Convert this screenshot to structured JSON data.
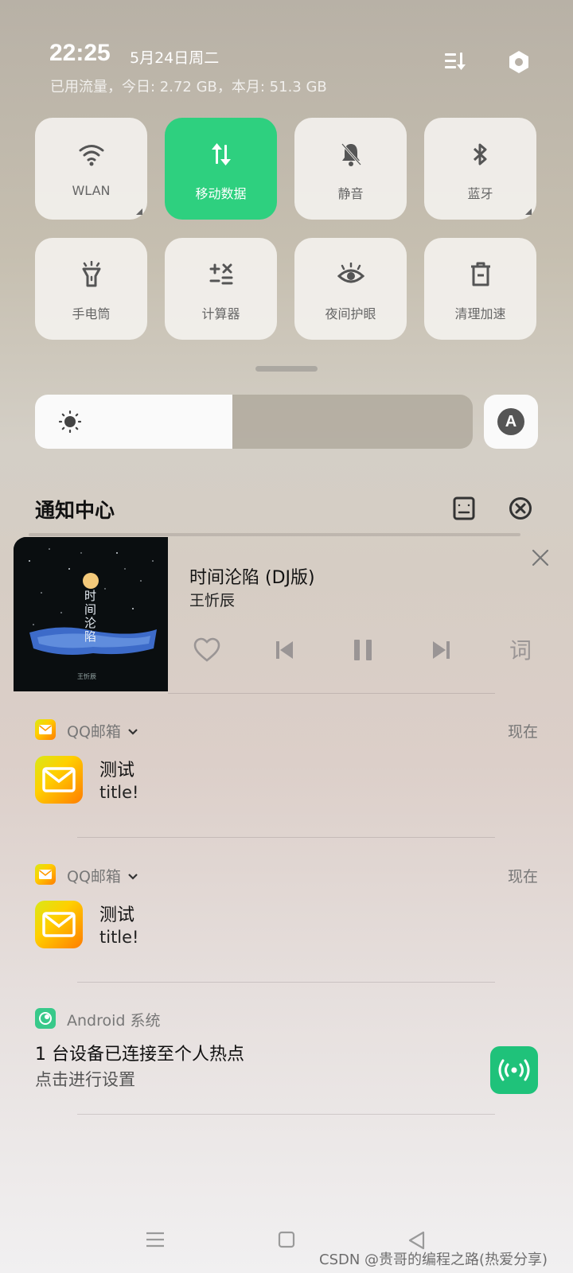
{
  "status": {
    "time": "22:25",
    "date": "5月24日周二",
    "usage": "已用流量，今日: 2.72 GB，本月: 51.3 GB"
  },
  "top_icons": {
    "edit": "edit-list-icon",
    "settings": "settings-hex-icon"
  },
  "quick_tiles": [
    {
      "label": "WLAN",
      "icon": "wifi-icon",
      "active": false
    },
    {
      "label": "移动数据",
      "icon": "mobile-data-icon",
      "active": true
    },
    {
      "label": "静音",
      "icon": "mute-bell-icon",
      "active": false
    },
    {
      "label": "蓝牙",
      "icon": "bluetooth-icon",
      "active": false
    },
    {
      "label": "手电筒",
      "icon": "flashlight-icon",
      "active": false
    },
    {
      "label": "计算器",
      "icon": "calculator-icon",
      "active": false
    },
    {
      "label": "夜间护眼",
      "icon": "eye-icon",
      "active": false
    },
    {
      "label": "清理加速",
      "icon": "trash-icon",
      "active": false
    }
  ],
  "brightness": {
    "level": 0.45,
    "auto_label": "A"
  },
  "notification_center": {
    "title": "通知中心"
  },
  "media": {
    "title": "时间沦陷 (DJ版)",
    "artist": "王忻辰",
    "album_text": "时间沦陷",
    "album_caption": "王忻辰",
    "lyric_label": "词"
  },
  "notifications": [
    {
      "app": "QQ邮箱",
      "time": "现在",
      "title": "测试",
      "body": "title!"
    },
    {
      "app": "QQ邮箱",
      "time": "现在",
      "title": "测试",
      "body": "title!"
    }
  ],
  "system_notification": {
    "app": "Android 系统",
    "title": "1 台设备已连接至个人热点",
    "body": "点击进行设置"
  },
  "watermark": "CSDN @贵哥的编程之路(热爱分享)",
  "colors": {
    "accent_green": "#2ed07f",
    "hotspot_green": "#1fc27a"
  }
}
